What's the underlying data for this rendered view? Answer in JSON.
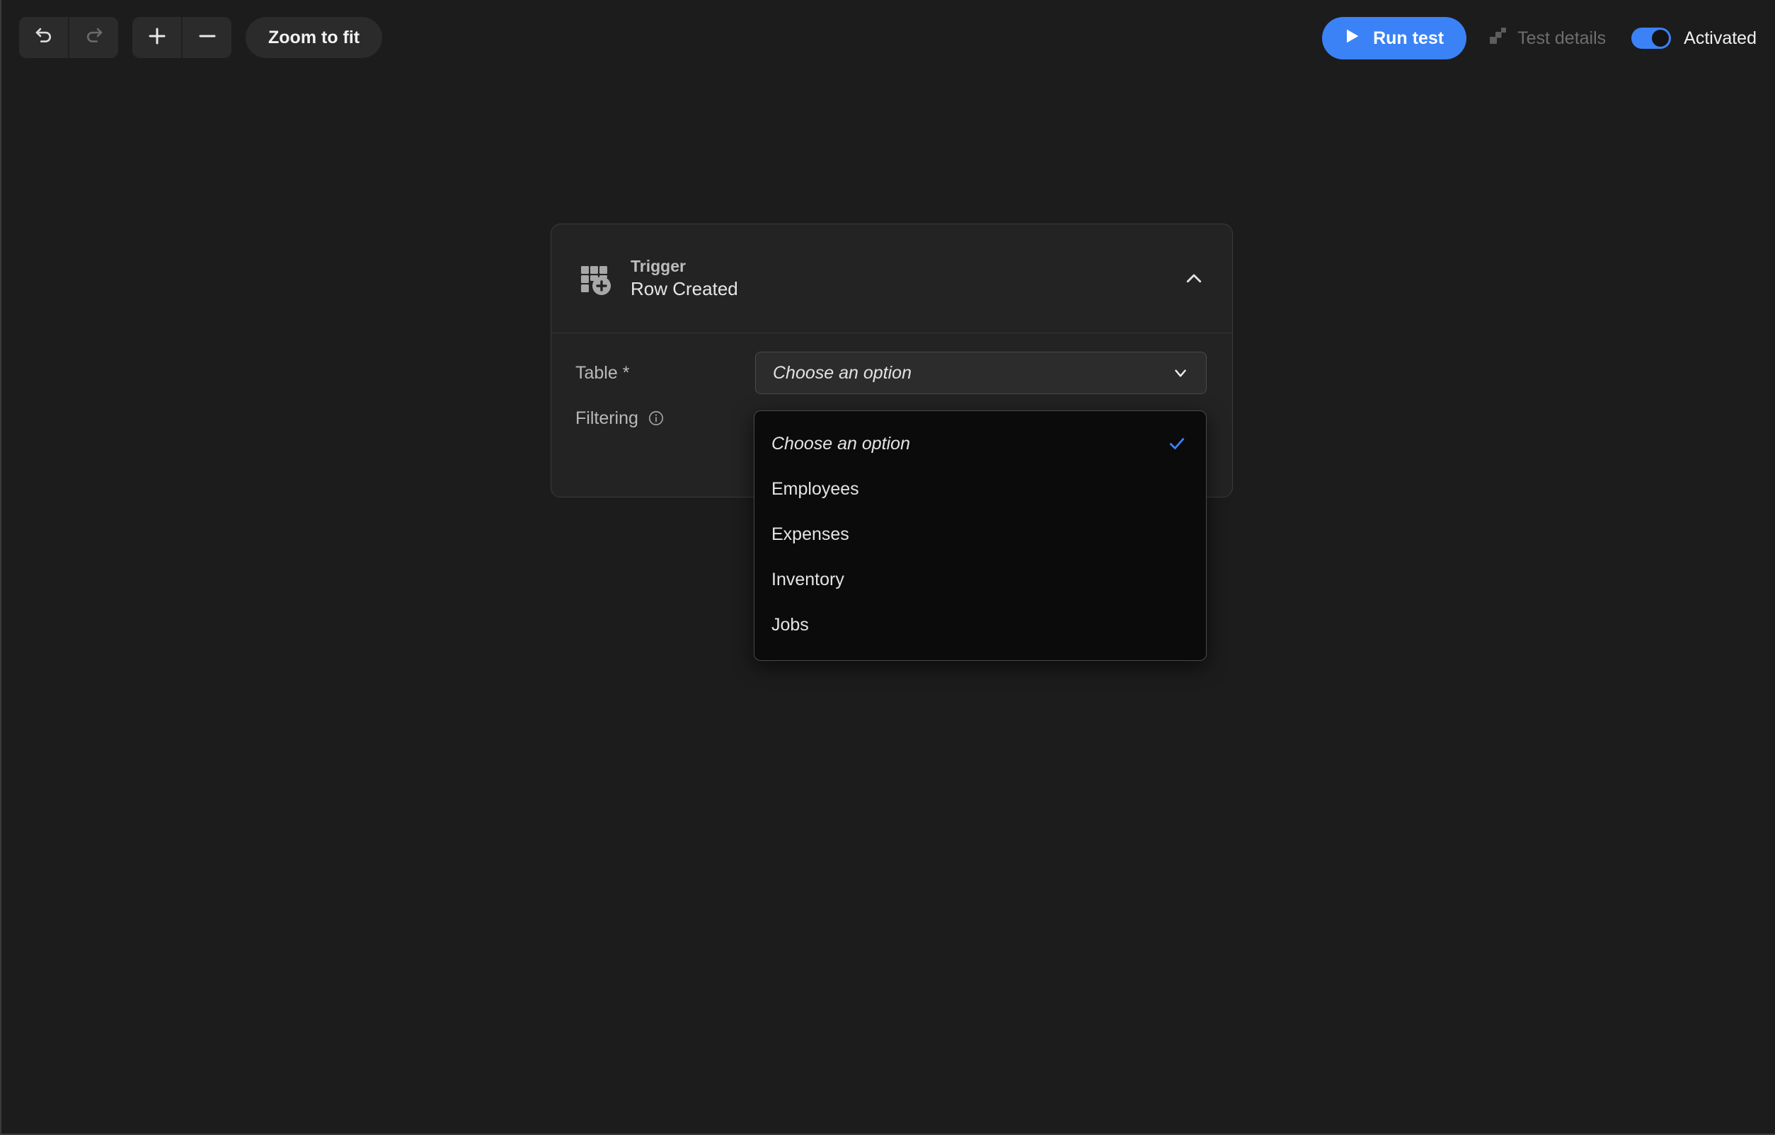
{
  "toolbar": {
    "undo_icon": "undo-arrow-icon",
    "redo_icon": "redo-arrow-icon",
    "zoom_in_icon": "plus-icon",
    "zoom_out_icon": "minus-icon",
    "zoom_to_fit_label": "Zoom to fit",
    "run_test_label": "Run test",
    "run_test_icon": "play-icon",
    "test_details_label": "Test details",
    "test_details_icon": "stacked-squares-icon",
    "activated_label": "Activated",
    "activated_toggle_state": "on"
  },
  "node": {
    "icon": "table-row-add-icon",
    "kind_label": "Trigger",
    "name_label": "Row Created",
    "collapse_icon": "chevron-up-icon",
    "fields": [
      {
        "label": "Table *",
        "control": "select",
        "value": "Choose an option",
        "caret_icon": "chevron-down-icon"
      },
      {
        "label": "Filtering",
        "control": "info",
        "info_icon": "info-circle-icon"
      }
    ]
  },
  "dropdown": {
    "open": true,
    "check_icon": "check-icon",
    "options": [
      {
        "label": "Choose an option",
        "italic": true,
        "selected": true
      },
      {
        "label": "Employees",
        "italic": false,
        "selected": false
      },
      {
        "label": "Expenses",
        "italic": false,
        "selected": false
      },
      {
        "label": "Inventory",
        "italic": false,
        "selected": false
      },
      {
        "label": "Jobs",
        "italic": false,
        "selected": false
      }
    ]
  },
  "colors": {
    "accent": "#3b82f6",
    "canvas_bg": "#1c1c1c",
    "card_bg": "#232323",
    "dropdown_bg": "#0b0b0b"
  }
}
